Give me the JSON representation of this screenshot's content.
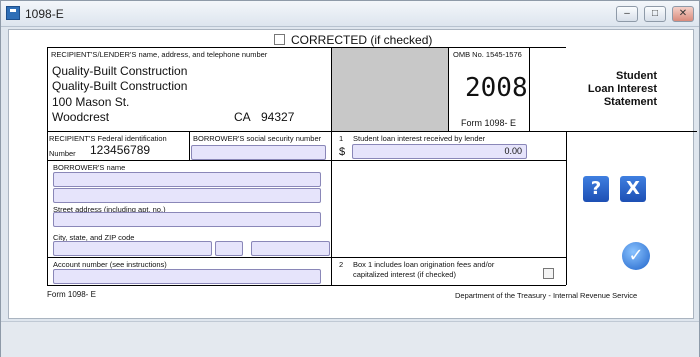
{
  "window": {
    "title": "1098-E"
  },
  "form": {
    "corrected_label": "CORRECTED  (if checked)",
    "recipient_label": "RECIPIENT'S/LENDER'S name, address, and telephone number",
    "recipient": {
      "line1": "Quality-Built Construction",
      "line2": "Quality-Built Construction",
      "street": "100 Mason St.",
      "city": "Woodcrest",
      "state": "CA",
      "zip": "94327"
    },
    "omb": "OMB No. 1545-1576",
    "year": "2008",
    "form_id": "Form 1098- E",
    "title_line1": "Student",
    "title_line2": "Loan Interest",
    "title_line3": "Statement",
    "recipient_fid_label": "RECIPIENT'S Federal identification",
    "recipient_fid_number_label": "Number",
    "recipient_fid": "123456789",
    "borrower_ssn_label": "BORROWER'S social security number",
    "box1_number": "1",
    "box1_label": "Student loan interest received by lender",
    "currency": "$",
    "box1_value": "0.00",
    "borrower_name_label": "BORROWER'S name",
    "street_label": "Street address (including apt. no.)",
    "city_label": "City, state, and ZIP code",
    "account_label": "Account number (see instructions)",
    "box2_number": "2",
    "box2_label_1": "Box  1  includes  loan  origination  fees  and/or",
    "box2_label_2": "capitalized interest (if checked)",
    "footer_form": "Form  1098- E",
    "footer_dept": "Department of the Treasury - Internal Revenue Service"
  },
  "buttons": {
    "help": "?",
    "close": "X",
    "ok": "✓"
  },
  "icons": [
    "app-icon",
    "minimize-icon",
    "maximize-icon",
    "close-window-icon",
    "help-icon",
    "close-icon",
    "ok-check-icon"
  ]
}
